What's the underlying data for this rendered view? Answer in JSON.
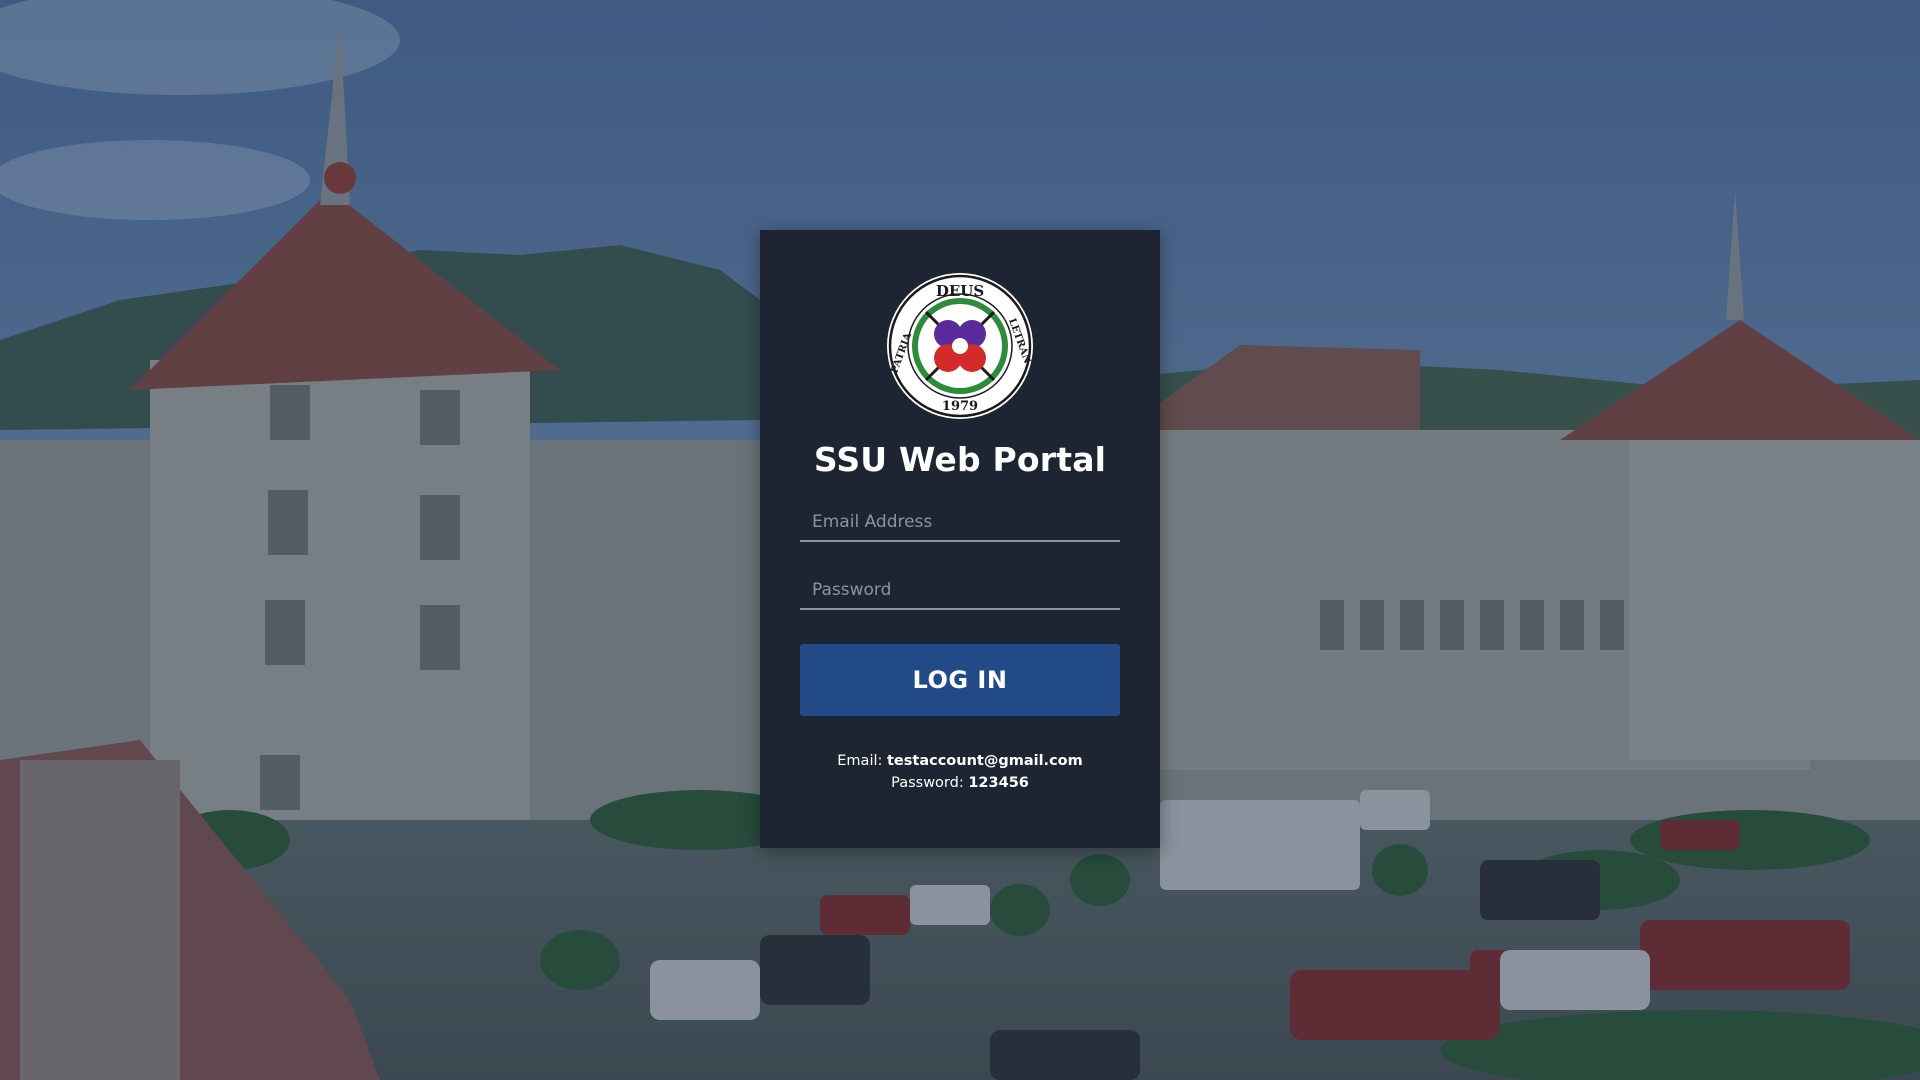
{
  "colors": {
    "card_bg": "#1e2532",
    "button_bg": "#214a87",
    "text": "#ffffff",
    "placeholder": "#8a93a3"
  },
  "background": {
    "image_alt": "campus-building-photo"
  },
  "logo": {
    "icon": "university-seal-icon",
    "top_text": "DEUS",
    "left_text": "PATRIA",
    "right_text": "LETRAN",
    "year": "1979"
  },
  "login": {
    "title": "SSU Web Portal",
    "email_placeholder": "Email Address",
    "email_value": "",
    "password_placeholder": "Password",
    "password_value": "",
    "button_label": "LOG IN"
  },
  "credentials": {
    "email_label": "Email: ",
    "email_value": "testaccount@gmail.com",
    "password_label": "Password: ",
    "password_value": "123456"
  }
}
